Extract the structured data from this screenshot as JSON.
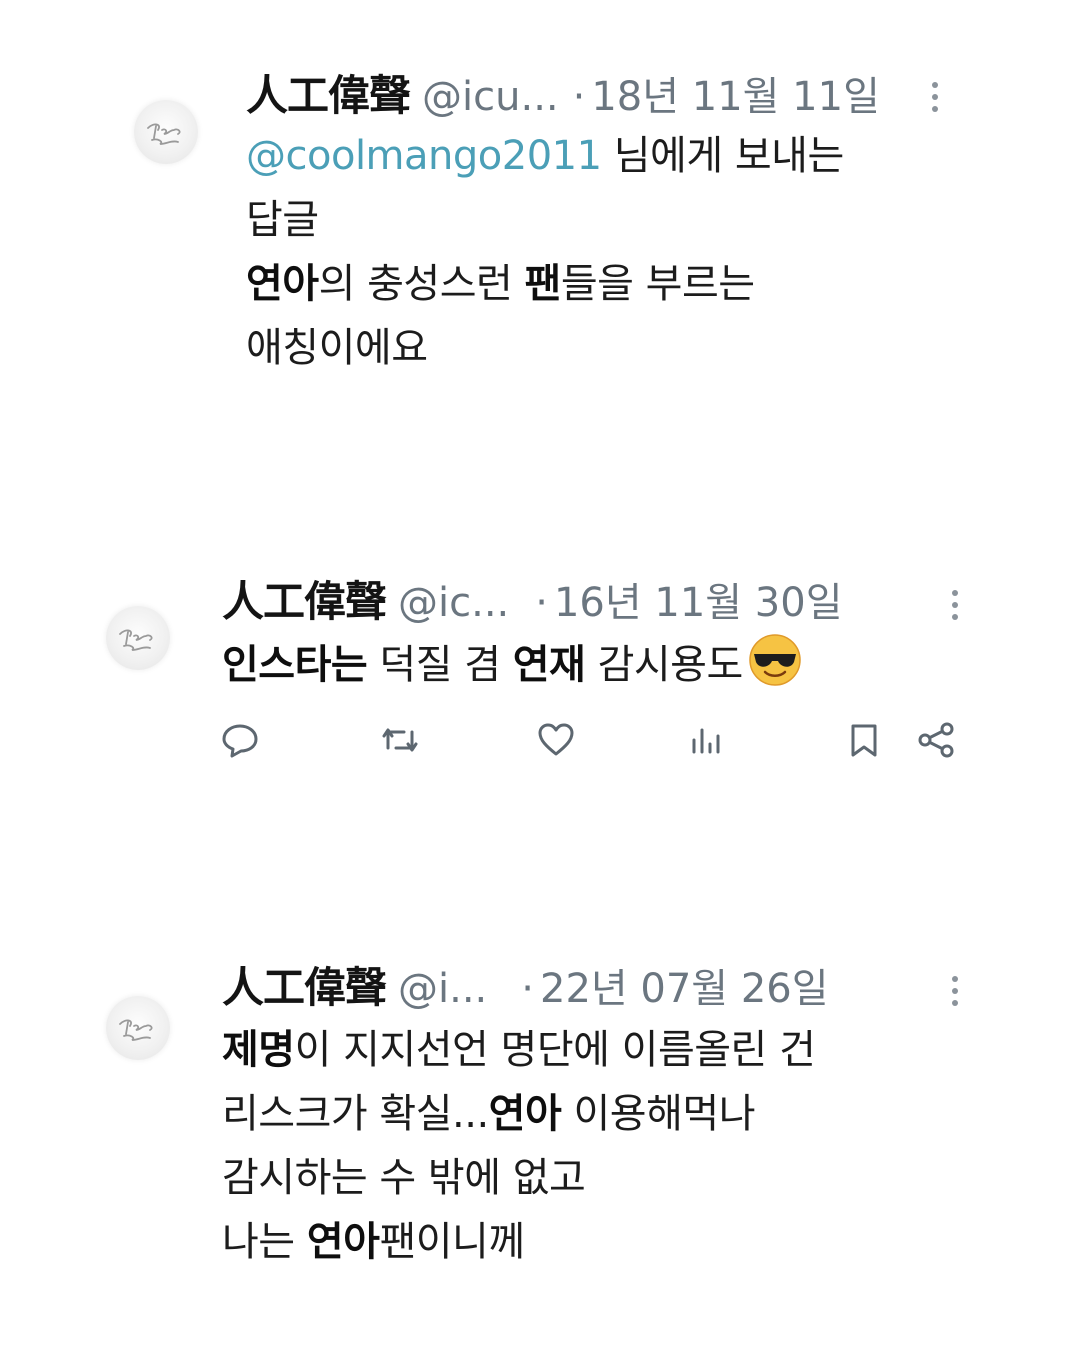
{
  "tweets": [
    {
      "name": "人工偉聲",
      "handle": "@icu...",
      "separator": "·",
      "date": "18년 11월 11일",
      "reply_mention": "@coolmango2011",
      "reply_suffix": " 님에게 보내는",
      "reply_line2": "답글",
      "text": {
        "l1a": "연아",
        "l1b": "의 충성스런 ",
        "l1c": "팬",
        "l1d": "들을 부르는",
        "l2": "애칭이에요"
      }
    },
    {
      "name": "人工偉聲",
      "handle": "@ic...",
      "separator": "·",
      "date": "16년 11월 30일",
      "text": {
        "l1a": "인스타는",
        "l1b": " 덕질 겸 ",
        "l1c": "연재",
        "l1d": " 감시용도"
      },
      "emoji": "smiling-face-with-sunglasses",
      "actions": [
        "reply-icon",
        "retweet-icon",
        "like-icon",
        "views-icon",
        "bookmark-icon",
        "share-icon"
      ]
    },
    {
      "name": "人工偉聲",
      "handle": "@i...",
      "separator": "·",
      "date": "22년 07월 26일",
      "text": {
        "l1a": "제명",
        "l1b": "이 지지선언 명단에 이름올린 건",
        "l2a": "리스크가 확실...",
        "l2b": "연아",
        "l2c": " 이용해먹나",
        "l3": "감시하는 수 밖에 없고",
        "l4a": "나는 ",
        "l4b": "연아",
        "l4c": "팬이니께"
      }
    }
  ],
  "colors": {
    "mention": "#4b9fb7",
    "meta": "#6b7680",
    "text": "#1c1c1c"
  }
}
